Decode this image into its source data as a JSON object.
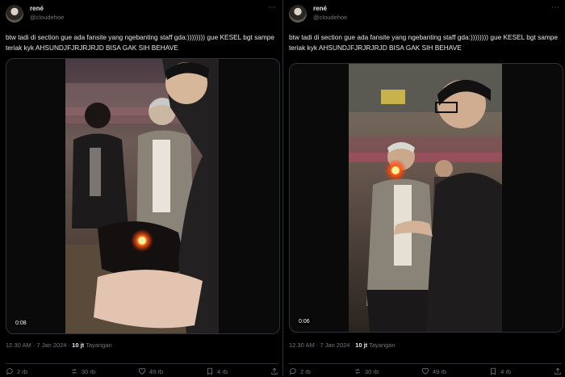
{
  "tweets": [
    {
      "user": {
        "name": "rené",
        "handle": "@cloudehoe"
      },
      "more": "⋯",
      "text": "btw tadi di section gue ada fansite yang ngebanting staff gda:)))))))) gue KESEL bgt sampe teriak kyk AHSUNDJFJRJRJRJD BISA GAK SIH BEHAVE",
      "video": {
        "time": "0:08"
      },
      "meta": {
        "timestamp": "12.30 AM · 7 Jan 2024 ·",
        "views": "10 jt",
        "views_label": "Tayangan"
      },
      "actions": {
        "replies": "2 rb",
        "reposts": "30 rb",
        "likes": "49 rb",
        "bookmarks": "4 rb"
      }
    },
    {
      "user": {
        "name": "rené",
        "handle": "@cloudehoe"
      },
      "more": "⋯",
      "text": "btw tadi di section gue ada fansite yang ngebanting staff gda:)))))))) gue KESEL bgt sampe teriak kyk AHSUNDJFJRJRJRJD BISA GAK SIH BEHAVE",
      "video": {
        "time": "0:06"
      },
      "meta": {
        "timestamp": "12.30 AM · 7 Jan 2024 ·",
        "views": "10 jt",
        "views_label": "Tayangan"
      },
      "actions": {
        "replies": "2 rb",
        "reposts": "30 rb",
        "likes": "49 rb",
        "bookmarks": "4 rb"
      }
    }
  ]
}
